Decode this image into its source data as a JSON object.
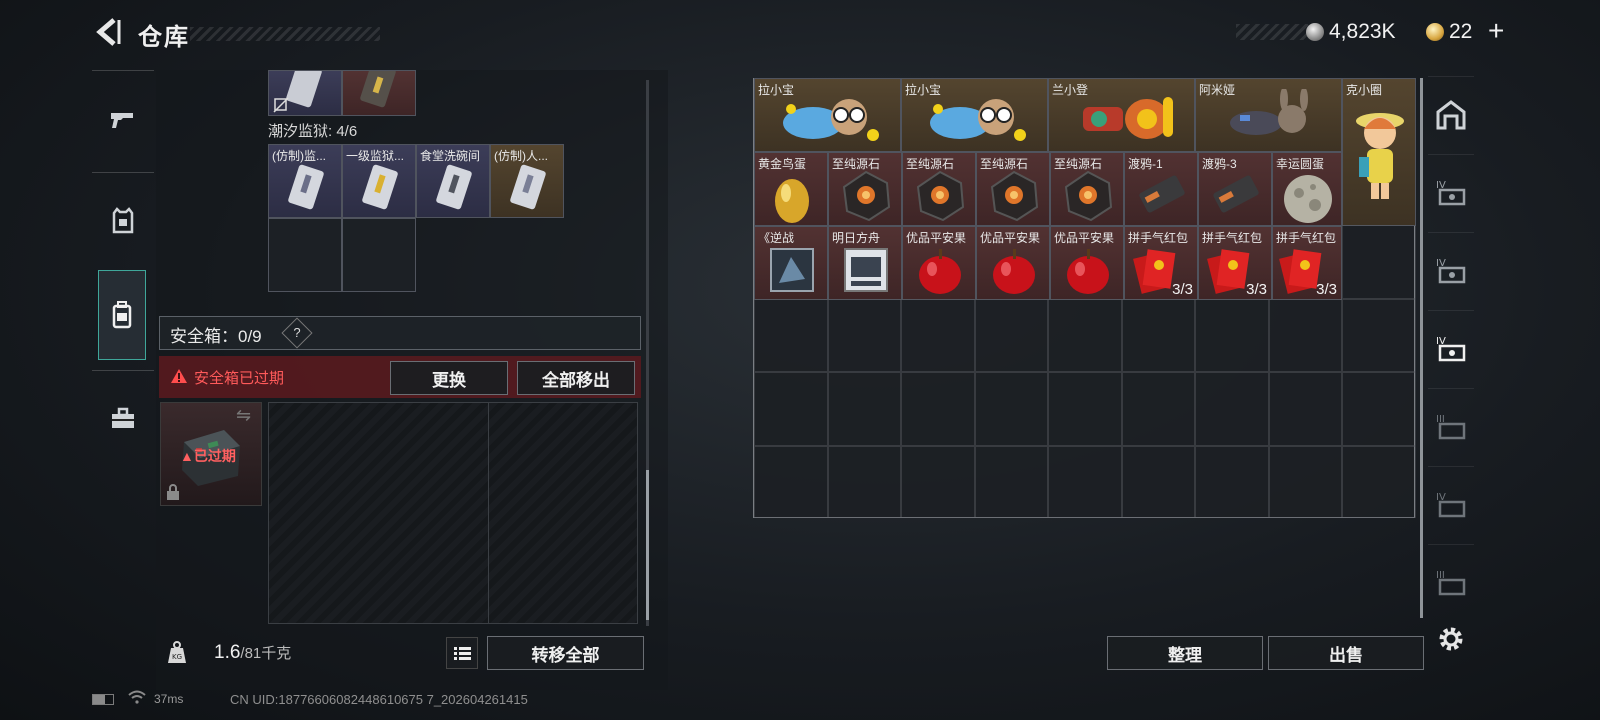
{
  "header": {
    "title": "仓库",
    "currency_silver": "4,823K",
    "currency_gold": "22",
    "currency_plus": "+"
  },
  "left_panel": {
    "tabs": [
      {
        "icon": "pistol-icon",
        "active": false
      },
      {
        "icon": "armor-vest-icon",
        "active": false
      },
      {
        "icon": "backpack-icon",
        "active": true
      },
      {
        "icon": "toolbox-icon",
        "active": false
      }
    ],
    "prison_label": "潮汐监狱: 4/6",
    "prison_items": [
      {
        "name": "(仿制)监...",
        "rarity": "blue"
      },
      {
        "name": "一级监狱...",
        "rarity": "blue"
      },
      {
        "name": "食堂洗碗间",
        "rarity": "blue"
      },
      {
        "name": "(仿制)人...",
        "rarity": "gold"
      }
    ],
    "safe_box_label": "安全箱：0/9",
    "safe_box_help": "?",
    "expired_warning": "安全箱已过期",
    "replace_button": "更换",
    "remove_all_button": "全部移出",
    "case_status": "已过期",
    "weight_value": "1.6",
    "weight_unit": "/81千克",
    "transfer_all_button": "转移全部"
  },
  "warehouse": {
    "items": [
      {
        "name": "拉小宝",
        "rarity": "gold",
        "icon": "plush-doll-icon"
      },
      {
        "name": "拉小宝",
        "rarity": "gold",
        "icon": "plush-doll-icon"
      },
      {
        "name": "兰小登",
        "rarity": "gold",
        "icon": "robot-toy-icon"
      },
      {
        "name": "阿米娅",
        "rarity": "gold",
        "icon": "bunny-figure-icon"
      },
      {
        "name": "克小圈",
        "rarity": "gold",
        "icon": "girl-figure-icon"
      },
      {
        "name": "黄金鸟蛋",
        "rarity": "red",
        "icon": "golden-egg-icon"
      },
      {
        "name": "至纯源石",
        "rarity": "red",
        "icon": "ore-crystal-icon"
      },
      {
        "name": "至纯源石",
        "rarity": "red",
        "icon": "ore-crystal-icon"
      },
      {
        "name": "至纯源石",
        "rarity": "red",
        "icon": "ore-crystal-icon"
      },
      {
        "name": "至纯源石",
        "rarity": "red",
        "icon": "ore-crystal-icon"
      },
      {
        "name": "渡鸦-1",
        "rarity": "red",
        "icon": "raven-card-icon"
      },
      {
        "name": "渡鸦-3",
        "rarity": "red",
        "icon": "raven-card-icon"
      },
      {
        "name": "幸运圆蛋",
        "rarity": "red",
        "icon": "moon-egg-icon"
      },
      {
        "name": "《逆战",
        "rarity": "red",
        "icon": "game-box-icon"
      },
      {
        "name": "明日方舟",
        "rarity": "red",
        "icon": "game-box-icon"
      },
      {
        "name": "优品平安果",
        "rarity": "red",
        "icon": "apple-icon"
      },
      {
        "name": "优品平安果",
        "rarity": "red",
        "icon": "apple-icon"
      },
      {
        "name": "优品平安果",
        "rarity": "red",
        "icon": "apple-icon"
      },
      {
        "name": "拼手气红包",
        "rarity": "red",
        "icon": "red-envelope-icon",
        "qty": "3/3"
      },
      {
        "name": "拼手气红包",
        "rarity": "red",
        "icon": "red-envelope-icon",
        "qty": "3/3"
      },
      {
        "name": "拼手气红包",
        "rarity": "red",
        "icon": "red-envelope-icon",
        "qty": "3/3"
      }
    ],
    "sort_button": "整理",
    "sell_button": "出售",
    "side_tabs": [
      "home-shelter-icon",
      "rack-iv-icon",
      "rack-iv-icon",
      "rack-iv-icon",
      "rack-iii-icon",
      "rack-iv-icon",
      "rack-iii-icon"
    ]
  },
  "status_bar": {
    "ping": "37ms",
    "uid": "CN UID:18776606082448610675 7_202604261415"
  },
  "colors": {
    "accent_teal": "#3fa79a",
    "warning_red": "#ff5a5a",
    "rarity_gold": "#54452f",
    "rarity_red": "#523232",
    "rarity_blue": "#3c3d58"
  }
}
